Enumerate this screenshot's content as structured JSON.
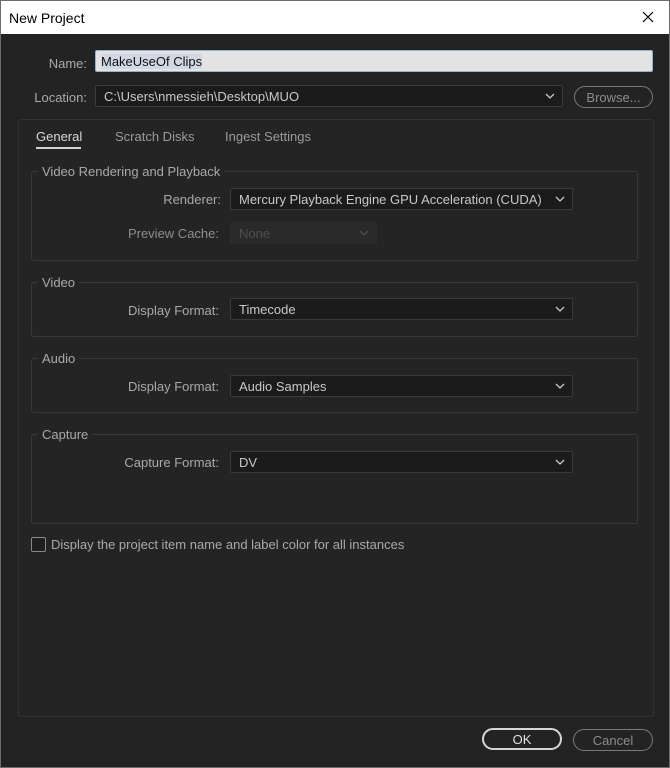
{
  "window": {
    "title": "New Project"
  },
  "name_field": {
    "label": "Name:",
    "value": "MakeUseOf Clips"
  },
  "location_field": {
    "label": "Location:",
    "value": "C:\\Users\\nmessieh\\Desktop\\MUO"
  },
  "browse_button": {
    "label": "Browse..."
  },
  "tabs": [
    {
      "label": "General",
      "active": true
    },
    {
      "label": "Scratch Disks",
      "active": false
    },
    {
      "label": "Ingest Settings",
      "active": false
    }
  ],
  "video_rendering": {
    "title": "Video Rendering and Playback",
    "renderer_label": "Renderer:",
    "renderer_value": "Mercury Playback Engine GPU Acceleration (CUDA)",
    "preview_cache_label": "Preview Cache:",
    "preview_cache_value": "None"
  },
  "video": {
    "title": "Video",
    "display_format_label": "Display Format:",
    "display_format_value": "Timecode"
  },
  "audio": {
    "title": "Audio",
    "display_format_label": "Display Format:",
    "display_format_value": "Audio Samples"
  },
  "capture": {
    "title": "Capture",
    "capture_format_label": "Capture Format:",
    "capture_format_value": "DV"
  },
  "display_item_checkbox": {
    "label": "Display the project item name and label color for all instances",
    "checked": false
  },
  "footer": {
    "ok_label": "OK",
    "cancel_label": "Cancel"
  },
  "colors": {
    "background": "#232323",
    "panel": "#242424",
    "field_dark": "#1b1b1b",
    "text": "#a9a9a9",
    "title_bar": "#ffffff"
  }
}
